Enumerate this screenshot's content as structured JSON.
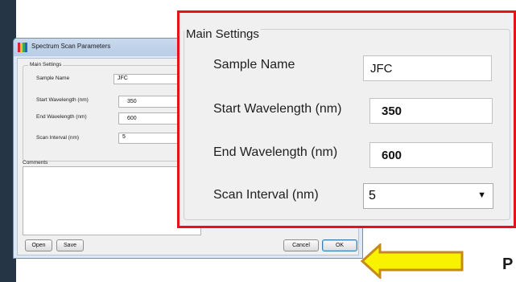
{
  "dialog": {
    "title": "Spectrum Scan Parameters",
    "section_title": "Main Settings",
    "fields": {
      "sample_name": {
        "label": "Sample Name",
        "value": "JFC"
      },
      "start_wavelength": {
        "label": "Start Wavelength (nm)",
        "value": "350"
      },
      "end_wavelength": {
        "label": "End Wavelength (nm)",
        "value": "600"
      },
      "scan_interval": {
        "label": "Scan Interval (nm)",
        "value": "5"
      }
    },
    "comments_label": "Comments",
    "buttons": {
      "open": "Open",
      "save": "Save",
      "cancel": "Cancel",
      "ok": "OK"
    }
  },
  "zoom": {
    "section_title": "Main Settings",
    "fields": {
      "sample_name": {
        "label": "Sample Name",
        "value": "JFC"
      },
      "start_wavelength": {
        "label": "Start Wavelength (nm)",
        "value": "350"
      },
      "end_wavelength": {
        "label": "End Wavelength (nm)",
        "value": "600"
      },
      "scan_interval": {
        "label": "Scan Interval (nm)",
        "value": "5"
      }
    }
  },
  "annotation": {
    "highlight_color": "#e8101d",
    "arrow_color": "#f8f200",
    "arrow_outline": "#c58a1e"
  },
  "cut_text": "P"
}
